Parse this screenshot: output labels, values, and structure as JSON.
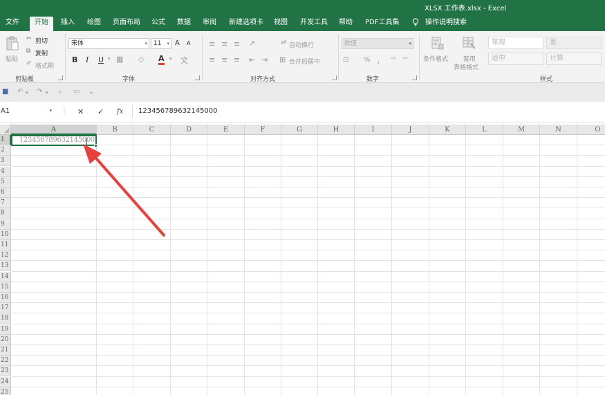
{
  "window": {
    "title": "XLSX 工作表.xlsx  -  Excel"
  },
  "tabs": [
    "文件",
    "开始",
    "插入",
    "绘图",
    "页面布局",
    "公式",
    "数据",
    "审阅",
    "新建选项卡",
    "视图",
    "开发工具",
    "帮助",
    "PDF工具集"
  ],
  "active_tab": "开始",
  "tell_me": "操作说明搜索",
  "ribbon": {
    "clipboard": {
      "paste": "粘贴",
      "cut": "剪切",
      "copy": "复制",
      "format_painter": "格式刷",
      "label": "剪贴板"
    },
    "font": {
      "name": "宋体",
      "size": "11",
      "grow": "A",
      "shrink": "A",
      "bold": "B",
      "italic": "I",
      "underline": "U",
      "font_color": "A",
      "label": "字体"
    },
    "alignment": {
      "wrap": "自动换行",
      "merge": "合并后居中",
      "label": "对齐方式"
    },
    "number": {
      "format": "数值",
      "percent": "%",
      "comma": "，",
      "label": "数字"
    },
    "styles": {
      "conditional": "条件格式",
      "table_format_1": "套用",
      "table_format_2": "表格格式",
      "normal": "常规",
      "bad": "差",
      "neutral": "适中",
      "calculation": "计算",
      "label": "样式"
    }
  },
  "formula_bar": {
    "name_box": "A1",
    "cancel": "✕",
    "enter": "✓",
    "fx": "fx",
    "value": "123456789632145000"
  },
  "sheet": {
    "columns": [
      "A",
      "B",
      "C",
      "D",
      "E",
      "F",
      "G",
      "H",
      "I",
      "J",
      "K",
      "L",
      "M",
      "N",
      "O"
    ],
    "rows": [
      "1",
      "2",
      "3",
      "4",
      "5",
      "6",
      "7",
      "8",
      "9",
      "10",
      "11",
      "12",
      "13",
      "14",
      "15",
      "16",
      "17",
      "18",
      "19",
      "20",
      "21",
      "22",
      "23",
      "24",
      "25"
    ],
    "active_cell": "A1",
    "a1_value": "123456789632145000"
  },
  "annotation": {
    "arrow_color": "#e8403a"
  },
  "colors": {
    "accent": "#217346"
  }
}
